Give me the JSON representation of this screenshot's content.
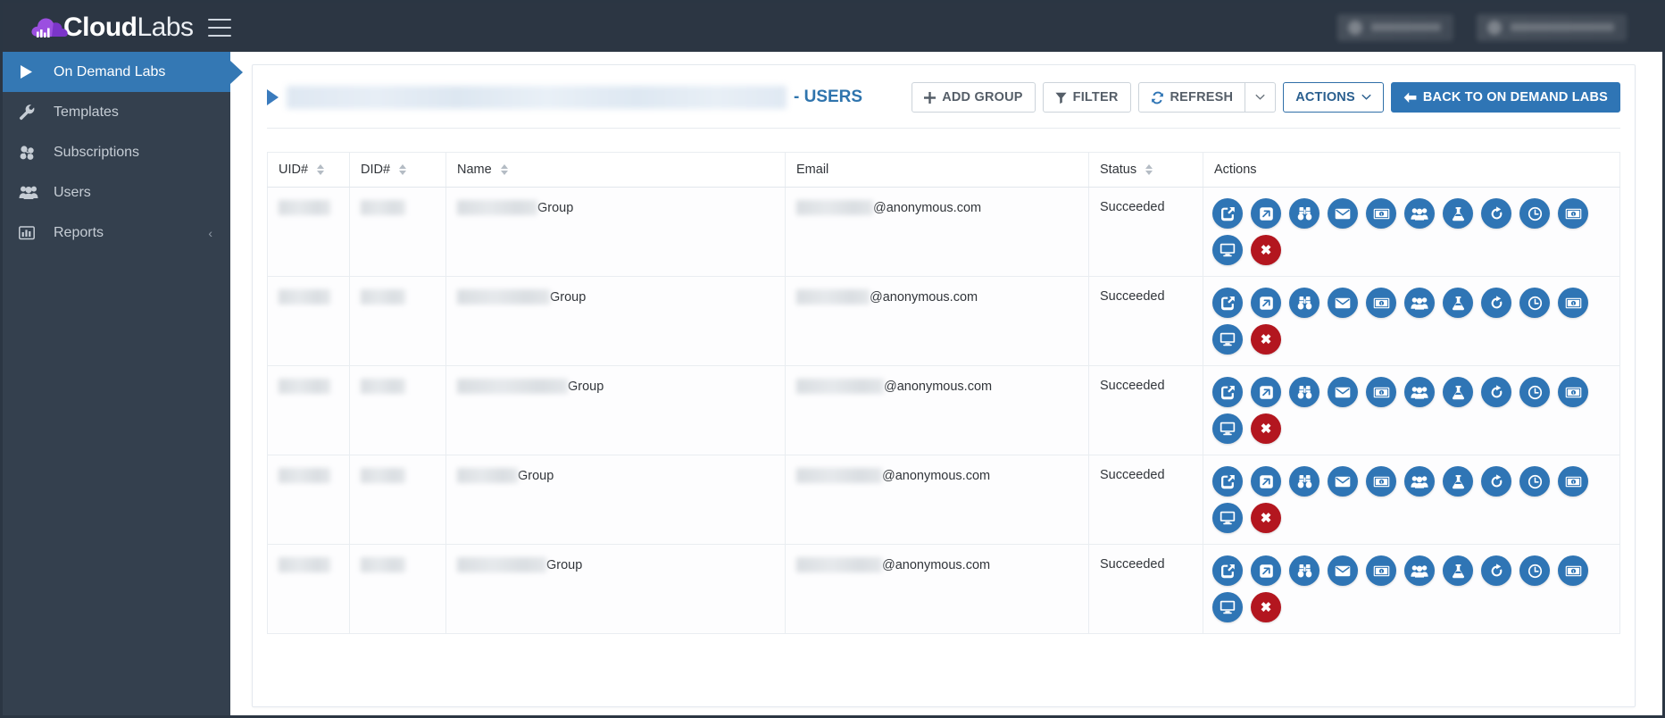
{
  "brand": {
    "name_bold": "Cloud",
    "name_light": "Labs",
    "logo_icon": "cloud-chart-logo",
    "menu_icon": "hamburger-menu-icon"
  },
  "header": {
    "right_items": [
      {
        "name": "user-account-redacted",
        "icon": "user-icon",
        "label": ""
      },
      {
        "name": "secondary-account-redacted",
        "icon": "building-icon",
        "label": ""
      }
    ]
  },
  "sidebar": {
    "items": [
      {
        "label": "On Demand Labs",
        "icon": "play-triangle-icon",
        "active": true,
        "chevron": ""
      },
      {
        "label": "Templates",
        "icon": "wrench-icon",
        "active": false,
        "chevron": ""
      },
      {
        "label": "Subscriptions",
        "icon": "cubes-icon",
        "active": false,
        "chevron": ""
      },
      {
        "label": "Users",
        "icon": "users-icon",
        "active": false,
        "chevron": ""
      },
      {
        "label": "Reports",
        "icon": "bar-chart-icon",
        "active": false,
        "chevron": "‹"
      }
    ]
  },
  "page": {
    "title_redacted": "",
    "title_suffix": "- USERS",
    "expand_icon": "play-triangle-icon"
  },
  "toolbar": {
    "add_group_label": "ADD GROUP",
    "add_group_icon": "plus-icon",
    "filter_label": "FILTER",
    "filter_icon": "funnel-icon",
    "refresh_label": "REFRESH",
    "refresh_icon": "refresh-icon",
    "refresh_caret": "⌄",
    "actions_label": "ACTIONS",
    "actions_caret": "⌄",
    "back_label": "BACK TO ON DEMAND LABS",
    "back_icon": "arrow-left-icon"
  },
  "table": {
    "columns": [
      {
        "key": "uid",
        "label": "UID#",
        "sortable": true
      },
      {
        "key": "did",
        "label": "DID#",
        "sortable": true
      },
      {
        "key": "name",
        "label": "Name",
        "sortable": true
      },
      {
        "key": "email",
        "label": "Email",
        "sortable": false
      },
      {
        "key": "status",
        "label": "Status",
        "sortable": true
      },
      {
        "key": "actions",
        "label": "Actions",
        "sortable": false
      }
    ],
    "row_actions": [
      {
        "name": "open-lab-button",
        "icon": "external-link-square-icon"
      },
      {
        "name": "launch-button",
        "icon": "arrow-up-right-square-icon"
      },
      {
        "name": "view-details-button",
        "icon": "binoculars-icon"
      },
      {
        "name": "send-email-button",
        "icon": "envelope-icon"
      },
      {
        "name": "view-cost-button",
        "icon": "money-bill-icon"
      },
      {
        "name": "manage-users-button",
        "icon": "users-group-icon"
      },
      {
        "name": "lab-environment-button",
        "icon": "flask-icon"
      },
      {
        "name": "retry-button",
        "icon": "redo-arrow-icon"
      },
      {
        "name": "extend-duration-button",
        "icon": "clock-icon"
      },
      {
        "name": "billing-button",
        "icon": "money-bill-1-icon"
      },
      {
        "name": "remote-desktop-button",
        "icon": "desktop-monitor-icon"
      },
      {
        "name": "delete-button",
        "icon": "close-x-icon",
        "danger": true,
        "glyph": "✖"
      }
    ],
    "rows": [
      {
        "uid": "",
        "did": "",
        "name_suffix": "Group",
        "email_suffix": "@anonymous.com",
        "status": "Succeeded",
        "uid_w": 58,
        "did_w": 50,
        "name_w": 90,
        "email_w": 86
      },
      {
        "uid": "",
        "did": "",
        "name_suffix": "Group",
        "email_suffix": "@anonymous.com",
        "status": "Succeeded",
        "uid_w": 58,
        "did_w": 50,
        "name_w": 104,
        "email_w": 82
      },
      {
        "uid": "",
        "did": "",
        "name_suffix": "Group",
        "email_suffix": "@anonymous.com",
        "status": "Succeeded",
        "uid_w": 58,
        "did_w": 50,
        "name_w": 124,
        "email_w": 98
      },
      {
        "uid": "",
        "did": "",
        "name_suffix": "Group",
        "email_suffix": "@anonymous.com",
        "status": "Succeeded",
        "uid_w": 58,
        "did_w": 50,
        "name_w": 68,
        "email_w": 96
      },
      {
        "uid": "",
        "did": "",
        "name_suffix": "Group",
        "email_suffix": "@anonymous.com",
        "status": "Succeeded",
        "uid_w": 58,
        "did_w": 50,
        "name_w": 100,
        "email_w": 96
      }
    ]
  },
  "colors": {
    "header_bg": "#2c3643",
    "sidebar_bg": "#34404e",
    "accent_blue": "#2f75b5",
    "active_blue": "#3478b4",
    "danger_red": "#b3161f",
    "title_blue": "#2f74ad"
  }
}
